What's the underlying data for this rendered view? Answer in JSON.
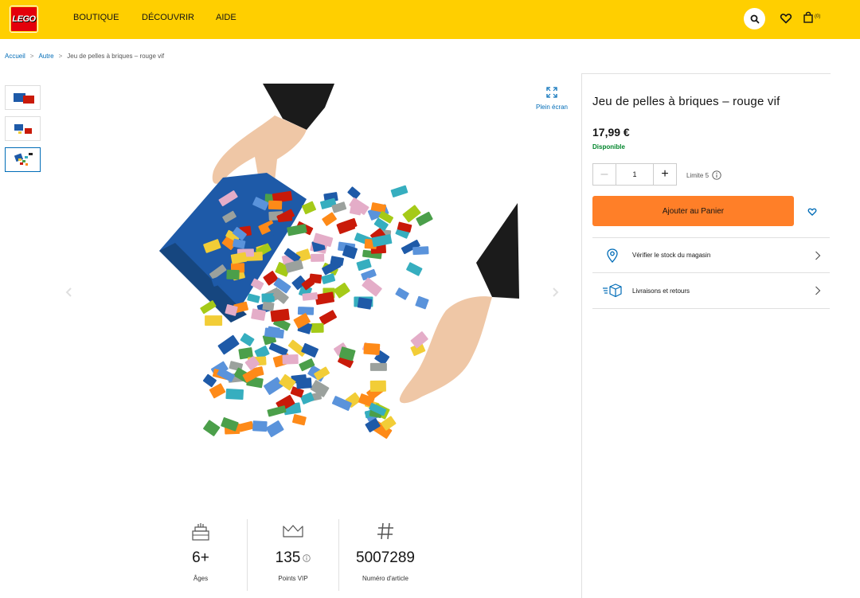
{
  "header": {
    "logo_text": "LEGO",
    "nav": [
      "BOUTIQUE",
      "DÉCOUVRIR",
      "AIDE"
    ],
    "bag_count": "(0)",
    "colors": {
      "bar": "#FFCF00",
      "logo": "#E3000B"
    }
  },
  "breadcrumb": [
    "Accueil",
    "Autre",
    "Jeu de pelles à briques – rouge vif"
  ],
  "gallery": {
    "fullscreen_label": "Plein écran",
    "thumbnails": [
      "thumbnail-1",
      "thumbnail-2",
      "thumbnail-3"
    ],
    "selected_thumbnail": 3
  },
  "specs": {
    "ages_value": "6+",
    "ages_label": "Âges",
    "vip_value": "135",
    "vip_label": "Points VIP",
    "item_value": "5007289",
    "item_label": "Numéro d'article"
  },
  "product": {
    "title": "Jeu de pelles à briques – rouge vif",
    "price": "17,99 €",
    "availability": "Disponible",
    "quantity": "1",
    "limit": "Limite 5",
    "add_to_cart": "Ajouter au Panier",
    "stock_check": "Vérifier le stock du magasin",
    "shipping": "Livraisons et retours",
    "colors": {
      "cta": "#FF7F28",
      "available": "#00852B",
      "link": "#006CB7"
    }
  }
}
